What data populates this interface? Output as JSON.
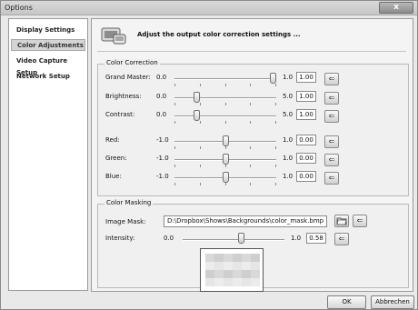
{
  "window": {
    "title": "Options",
    "close_label": "x"
  },
  "sidebar": {
    "items": [
      {
        "label": "Display Settings",
        "selected": false
      },
      {
        "label": "Color Adjustments",
        "selected": true
      },
      {
        "label": "Video Capture Setup",
        "selected": false
      },
      {
        "label": "Network Setup",
        "selected": false
      }
    ]
  },
  "header": {
    "text": "Adjust the output color correction settings ...",
    "icon": "display-settings-icon"
  },
  "color_correction": {
    "title": "Color Correction",
    "rows": [
      {
        "label": "Grand Master:",
        "min": "0.0",
        "max": "1.0",
        "value": "1.00",
        "fraction": 1.0
      },
      {
        "label": "Brightness:",
        "min": "0.0",
        "max": "5.0",
        "value": "1.00",
        "fraction": 0.2
      },
      {
        "label": "Contrast:",
        "min": "0.0",
        "max": "5.0",
        "value": "1.00",
        "fraction": 0.2
      },
      {
        "label": "Red:",
        "min": "-1.0",
        "max": "1.0",
        "value": "0.00",
        "fraction": 0.5
      },
      {
        "label": "Green:",
        "min": "-1.0",
        "max": "1.0",
        "value": "0.00",
        "fraction": 0.5
      },
      {
        "label": "Blue:",
        "min": "-1.0",
        "max": "1.0",
        "value": "0.00",
        "fraction": 0.5
      }
    ]
  },
  "color_masking": {
    "title": "Color Masking",
    "image_mask_label": "Image Mask:",
    "image_mask_path": "D:\\Dropbox\\Shows\\Backgrounds\\color_mask.bmp",
    "intensity": {
      "label": "Intensity:",
      "min": "0.0",
      "max": "1.0",
      "value": "0.58",
      "fraction": 0.58
    }
  },
  "footer": {
    "ok_label": "OK",
    "cancel_label": "Abbrechen"
  },
  "colors": {
    "selected_item": "#d4d4d4",
    "panel": "#f4f4f4",
    "window": "#e9e9e9"
  }
}
